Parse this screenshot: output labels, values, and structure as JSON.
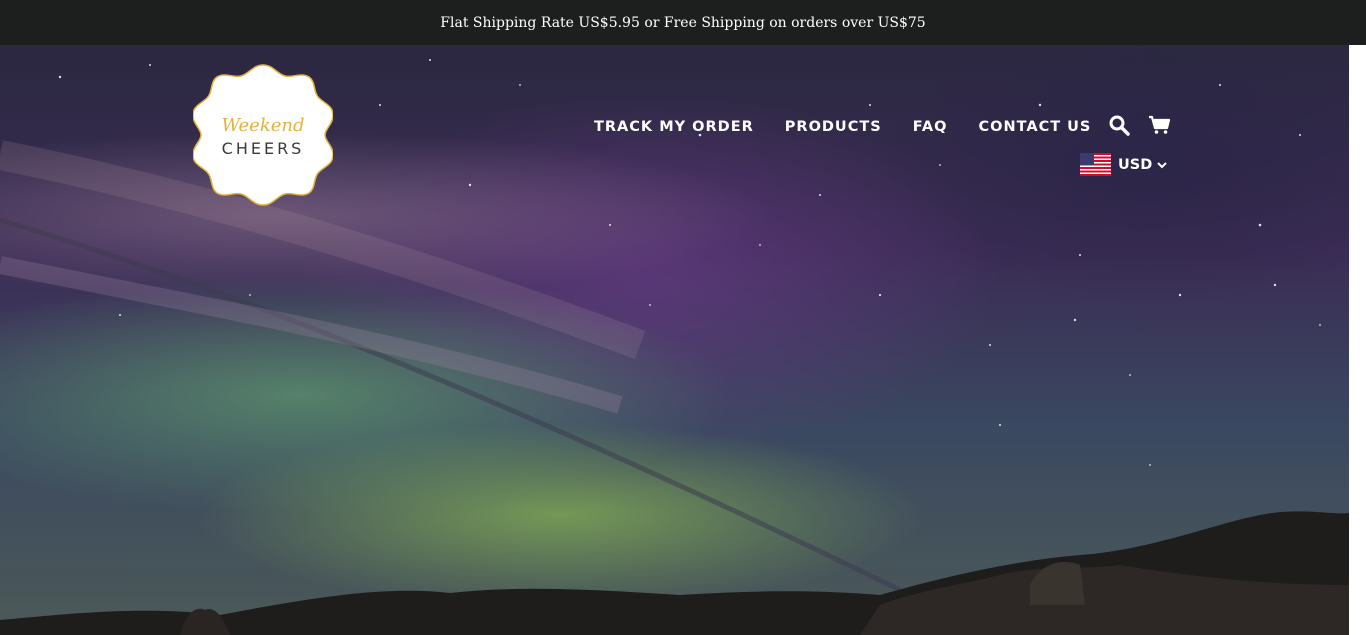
{
  "announcement": {
    "text": "Flat Shipping Rate US$5.95 or Free Shipping on orders over US$75"
  },
  "logo": {
    "line1": "Weekend",
    "line2": "CHEERS",
    "accent_color": "#e3b23c"
  },
  "nav": {
    "items": [
      {
        "label": "TRACK MY ORDER"
      },
      {
        "label": "PRODUCTS"
      },
      {
        "label": "FAQ"
      },
      {
        "label": "CONTACT US"
      }
    ],
    "icons": [
      "search-icon",
      "cart-icon"
    ]
  },
  "currency": {
    "selected": "USD",
    "flag": "us-flag-icon"
  },
  "hero": {
    "image": "aurora-night-sky-over-mountains"
  }
}
